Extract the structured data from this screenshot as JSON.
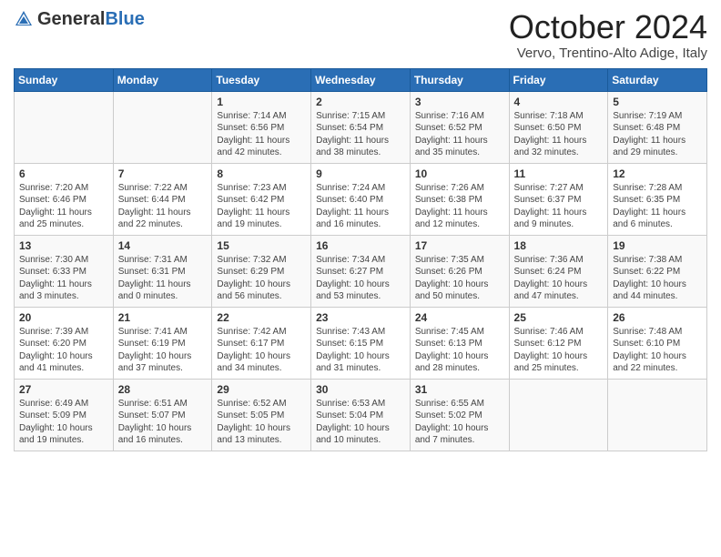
{
  "header": {
    "logo": {
      "line1": "General",
      "line2": "Blue"
    },
    "month_title": "October 2024",
    "location": "Vervo, Trentino-Alto Adige, Italy"
  },
  "days_of_week": [
    "Sunday",
    "Monday",
    "Tuesday",
    "Wednesday",
    "Thursday",
    "Friday",
    "Saturday"
  ],
  "weeks": [
    [
      {
        "day": "",
        "sunrise": "",
        "sunset": "",
        "daylight": ""
      },
      {
        "day": "",
        "sunrise": "",
        "sunset": "",
        "daylight": ""
      },
      {
        "day": "1",
        "sunrise": "Sunrise: 7:14 AM",
        "sunset": "Sunset: 6:56 PM",
        "daylight": "Daylight: 11 hours and 42 minutes."
      },
      {
        "day": "2",
        "sunrise": "Sunrise: 7:15 AM",
        "sunset": "Sunset: 6:54 PM",
        "daylight": "Daylight: 11 hours and 38 minutes."
      },
      {
        "day": "3",
        "sunrise": "Sunrise: 7:16 AM",
        "sunset": "Sunset: 6:52 PM",
        "daylight": "Daylight: 11 hours and 35 minutes."
      },
      {
        "day": "4",
        "sunrise": "Sunrise: 7:18 AM",
        "sunset": "Sunset: 6:50 PM",
        "daylight": "Daylight: 11 hours and 32 minutes."
      },
      {
        "day": "5",
        "sunrise": "Sunrise: 7:19 AM",
        "sunset": "Sunset: 6:48 PM",
        "daylight": "Daylight: 11 hours and 29 minutes."
      }
    ],
    [
      {
        "day": "6",
        "sunrise": "Sunrise: 7:20 AM",
        "sunset": "Sunset: 6:46 PM",
        "daylight": "Daylight: 11 hours and 25 minutes."
      },
      {
        "day": "7",
        "sunrise": "Sunrise: 7:22 AM",
        "sunset": "Sunset: 6:44 PM",
        "daylight": "Daylight: 11 hours and 22 minutes."
      },
      {
        "day": "8",
        "sunrise": "Sunrise: 7:23 AM",
        "sunset": "Sunset: 6:42 PM",
        "daylight": "Daylight: 11 hours and 19 minutes."
      },
      {
        "day": "9",
        "sunrise": "Sunrise: 7:24 AM",
        "sunset": "Sunset: 6:40 PM",
        "daylight": "Daylight: 11 hours and 16 minutes."
      },
      {
        "day": "10",
        "sunrise": "Sunrise: 7:26 AM",
        "sunset": "Sunset: 6:38 PM",
        "daylight": "Daylight: 11 hours and 12 minutes."
      },
      {
        "day": "11",
        "sunrise": "Sunrise: 7:27 AM",
        "sunset": "Sunset: 6:37 PM",
        "daylight": "Daylight: 11 hours and 9 minutes."
      },
      {
        "day": "12",
        "sunrise": "Sunrise: 7:28 AM",
        "sunset": "Sunset: 6:35 PM",
        "daylight": "Daylight: 11 hours and 6 minutes."
      }
    ],
    [
      {
        "day": "13",
        "sunrise": "Sunrise: 7:30 AM",
        "sunset": "Sunset: 6:33 PM",
        "daylight": "Daylight: 11 hours and 3 minutes."
      },
      {
        "day": "14",
        "sunrise": "Sunrise: 7:31 AM",
        "sunset": "Sunset: 6:31 PM",
        "daylight": "Daylight: 11 hours and 0 minutes."
      },
      {
        "day": "15",
        "sunrise": "Sunrise: 7:32 AM",
        "sunset": "Sunset: 6:29 PM",
        "daylight": "Daylight: 10 hours and 56 minutes."
      },
      {
        "day": "16",
        "sunrise": "Sunrise: 7:34 AM",
        "sunset": "Sunset: 6:27 PM",
        "daylight": "Daylight: 10 hours and 53 minutes."
      },
      {
        "day": "17",
        "sunrise": "Sunrise: 7:35 AM",
        "sunset": "Sunset: 6:26 PM",
        "daylight": "Daylight: 10 hours and 50 minutes."
      },
      {
        "day": "18",
        "sunrise": "Sunrise: 7:36 AM",
        "sunset": "Sunset: 6:24 PM",
        "daylight": "Daylight: 10 hours and 47 minutes."
      },
      {
        "day": "19",
        "sunrise": "Sunrise: 7:38 AM",
        "sunset": "Sunset: 6:22 PM",
        "daylight": "Daylight: 10 hours and 44 minutes."
      }
    ],
    [
      {
        "day": "20",
        "sunrise": "Sunrise: 7:39 AM",
        "sunset": "Sunset: 6:20 PM",
        "daylight": "Daylight: 10 hours and 41 minutes."
      },
      {
        "day": "21",
        "sunrise": "Sunrise: 7:41 AM",
        "sunset": "Sunset: 6:19 PM",
        "daylight": "Daylight: 10 hours and 37 minutes."
      },
      {
        "day": "22",
        "sunrise": "Sunrise: 7:42 AM",
        "sunset": "Sunset: 6:17 PM",
        "daylight": "Daylight: 10 hours and 34 minutes."
      },
      {
        "day": "23",
        "sunrise": "Sunrise: 7:43 AM",
        "sunset": "Sunset: 6:15 PM",
        "daylight": "Daylight: 10 hours and 31 minutes."
      },
      {
        "day": "24",
        "sunrise": "Sunrise: 7:45 AM",
        "sunset": "Sunset: 6:13 PM",
        "daylight": "Daylight: 10 hours and 28 minutes."
      },
      {
        "day": "25",
        "sunrise": "Sunrise: 7:46 AM",
        "sunset": "Sunset: 6:12 PM",
        "daylight": "Daylight: 10 hours and 25 minutes."
      },
      {
        "day": "26",
        "sunrise": "Sunrise: 7:48 AM",
        "sunset": "Sunset: 6:10 PM",
        "daylight": "Daylight: 10 hours and 22 minutes."
      }
    ],
    [
      {
        "day": "27",
        "sunrise": "Sunrise: 6:49 AM",
        "sunset": "Sunset: 5:09 PM",
        "daylight": "Daylight: 10 hours and 19 minutes."
      },
      {
        "day": "28",
        "sunrise": "Sunrise: 6:51 AM",
        "sunset": "Sunset: 5:07 PM",
        "daylight": "Daylight: 10 hours and 16 minutes."
      },
      {
        "day": "29",
        "sunrise": "Sunrise: 6:52 AM",
        "sunset": "Sunset: 5:05 PM",
        "daylight": "Daylight: 10 hours and 13 minutes."
      },
      {
        "day": "30",
        "sunrise": "Sunrise: 6:53 AM",
        "sunset": "Sunset: 5:04 PM",
        "daylight": "Daylight: 10 hours and 10 minutes."
      },
      {
        "day": "31",
        "sunrise": "Sunrise: 6:55 AM",
        "sunset": "Sunset: 5:02 PM",
        "daylight": "Daylight: 10 hours and 7 minutes."
      },
      {
        "day": "",
        "sunrise": "",
        "sunset": "",
        "daylight": ""
      },
      {
        "day": "",
        "sunrise": "",
        "sunset": "",
        "daylight": ""
      }
    ]
  ]
}
